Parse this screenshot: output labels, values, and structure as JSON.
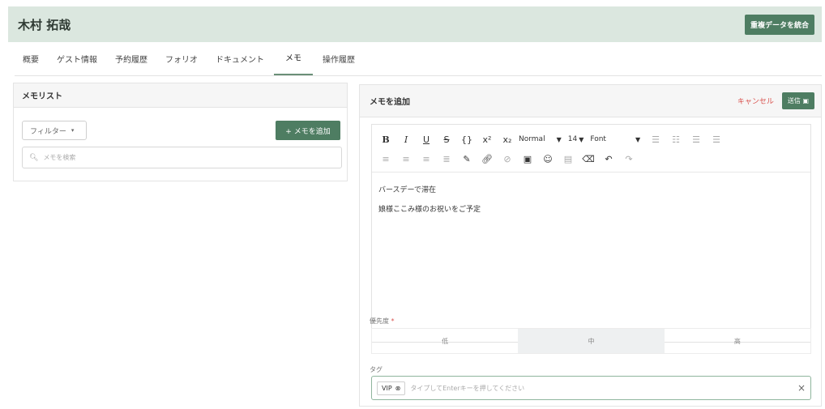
{
  "header": {
    "title": "木村 拓哉",
    "merge_button": "重複データを統合"
  },
  "tabs": [
    {
      "label": "概要"
    },
    {
      "label": "ゲスト情報"
    },
    {
      "label": "予約履歴"
    },
    {
      "label": "フォリオ"
    },
    {
      "label": "ドキュメント"
    },
    {
      "label": "メモ",
      "active": true
    },
    {
      "label": "操作履歴"
    }
  ],
  "memo_list": {
    "title": "メモリスト",
    "filter_label": "フィルター",
    "add_button": "+ メモを追加",
    "search_placeholder": "メモを検索"
  },
  "add_memo": {
    "title": "メモを追加",
    "cancel": "キャンセル",
    "send": "送信",
    "toolbar": {
      "format_select": "Normal",
      "size_select": "14",
      "font_select": "Font"
    },
    "content": [
      "バースデーで滞在",
      "娘様ここみ様のお祝いをご予定"
    ],
    "priority_label": "優先度",
    "priority_options": [
      "低",
      "中",
      "高"
    ],
    "priority_selected": "中",
    "tag_label": "タグ",
    "tags": [
      "VIP"
    ],
    "tag_placeholder": "タイプしてEnterキーを押してください"
  },
  "colors": {
    "accent": "#4e7d62",
    "header_bg": "#dbe7df",
    "cancel": "#d9534f"
  }
}
